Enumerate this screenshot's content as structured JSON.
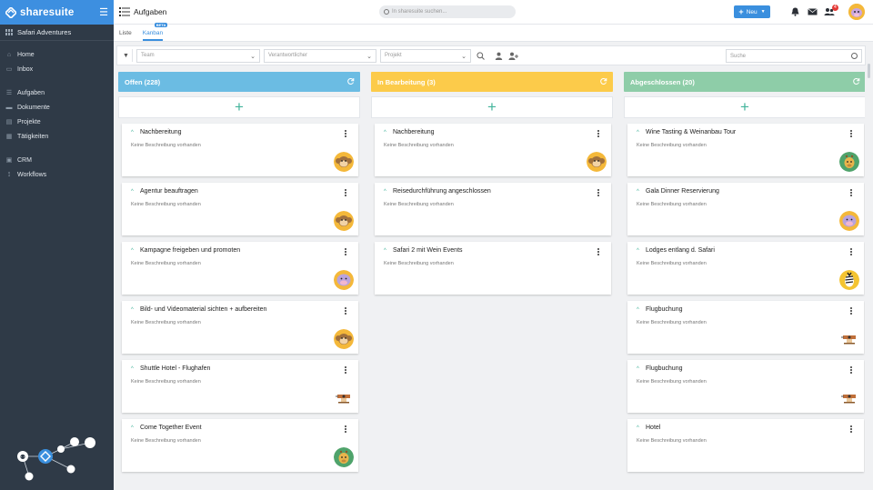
{
  "sidebar": {
    "brand": "sharesuite",
    "workspace": "Safari Adventures",
    "nav_main": [
      {
        "label": "Home",
        "icon": "home-icon"
      },
      {
        "label": "Inbox",
        "icon": "inbox-icon"
      }
    ],
    "nav_work": [
      {
        "label": "Aufgaben",
        "icon": "list-icon"
      },
      {
        "label": "Dokumente",
        "icon": "folder-icon"
      },
      {
        "label": "Projekte",
        "icon": "project-icon"
      },
      {
        "label": "Tätigkeiten",
        "icon": "activity-icon"
      }
    ],
    "nav_extra": [
      {
        "label": "CRM",
        "icon": "crm-icon"
      },
      {
        "label": "Workflows",
        "icon": "workflow-icon"
      }
    ]
  },
  "topbar": {
    "title": "Aufgaben",
    "search_placeholder": "In sharesuite suchen...",
    "new_button": "Neu",
    "notification_count": "4"
  },
  "tabs": [
    {
      "label": "Liste",
      "active": false
    },
    {
      "label": "Kanban",
      "active": true,
      "badge": "BETA"
    }
  ],
  "filters": {
    "team": "Team",
    "verantwortlicher": "Verantwortlicher",
    "projekt": "Projekt",
    "suche": "Suche"
  },
  "colors": {
    "offen": "#6bbce3",
    "in_bearbeitung": "#fccb4a",
    "abgeschlossen": "#8ecda8",
    "accent": "#3a8fde",
    "plus": "#43b49b"
  },
  "columns": [
    {
      "title": "Offen (228)",
      "cards": [
        {
          "title": "Nachbereitung",
          "desc": "Keine Beschreibung vorhanden",
          "avatar": "monkey"
        },
        {
          "title": "Agentur beauftragen",
          "desc": "Keine Beschreibung vorhanden",
          "avatar": "monkey"
        },
        {
          "title": "Kampagne freigeben und promoten",
          "desc": "Keine Beschreibung vorhanden",
          "avatar": "hippo"
        },
        {
          "title": "Bild- und Videomaterial sichten + aufbereiten",
          "desc": "Keine Beschreibung vorhanden",
          "avatar": "monkey"
        },
        {
          "title": "Shuttle Hotel - Flughafen",
          "desc": "Keine Beschreibung vorhanden",
          "avatar": "plane"
        },
        {
          "title": "Come Together Event",
          "desc": "Keine Beschreibung vorhanden",
          "avatar": "giraffe"
        }
      ]
    },
    {
      "title": "In Bearbeitung (3)",
      "cards": [
        {
          "title": "Nachbereitung",
          "desc": "Keine Beschreibung vorhanden",
          "avatar": "monkey"
        },
        {
          "title": "Reisedurchführung angeschlossen",
          "desc": "Keine Beschreibung vorhanden",
          "avatar": ""
        },
        {
          "title": "Safari 2 mit Wein Events",
          "desc": "Keine Beschreibung vorhanden",
          "avatar": ""
        }
      ]
    },
    {
      "title": "Abgeschlossen (20)",
      "cards": [
        {
          "title": "Wine Tasting & Weinanbau Tour",
          "desc": "Keine Beschreibung vorhanden",
          "avatar": "giraffe"
        },
        {
          "title": "Gala Dinner Reservierung",
          "desc": "Keine Beschreibung vorhanden",
          "avatar": "hippo"
        },
        {
          "title": "Lodges entlang d. Safari",
          "desc": "Keine Beschreibung vorhanden",
          "avatar": "zebra"
        },
        {
          "title": "Flugbuchung",
          "desc": "Keine Beschreibung vorhanden",
          "avatar": "plane"
        },
        {
          "title": "Flugbuchung",
          "desc": "Keine Beschreibung vorhanden",
          "avatar": "plane"
        },
        {
          "title": "Hotel",
          "desc": "Keine Beschreibung vorhanden",
          "avatar": ""
        }
      ]
    }
  ]
}
